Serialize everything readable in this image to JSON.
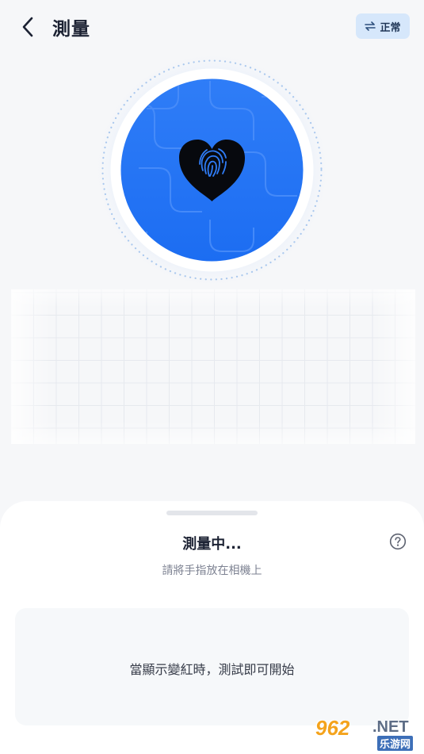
{
  "header": {
    "title": "測量",
    "mode_label": "正常",
    "back_icon": "chevron-left-icon",
    "mode_icon": "swap-arrows-icon"
  },
  "sensor": {
    "icon": "heart-fingerprint-icon",
    "accent_color": "#2f7cf6"
  },
  "sheet": {
    "status": "測量中...",
    "instruction": "請將手指放在相機上",
    "info": "當顯示變紅時，測試即可開始",
    "help_icon": "question-circle-icon"
  },
  "watermark": {
    "number": "962",
    "suffix": ".NET",
    "site": "乐游网"
  }
}
